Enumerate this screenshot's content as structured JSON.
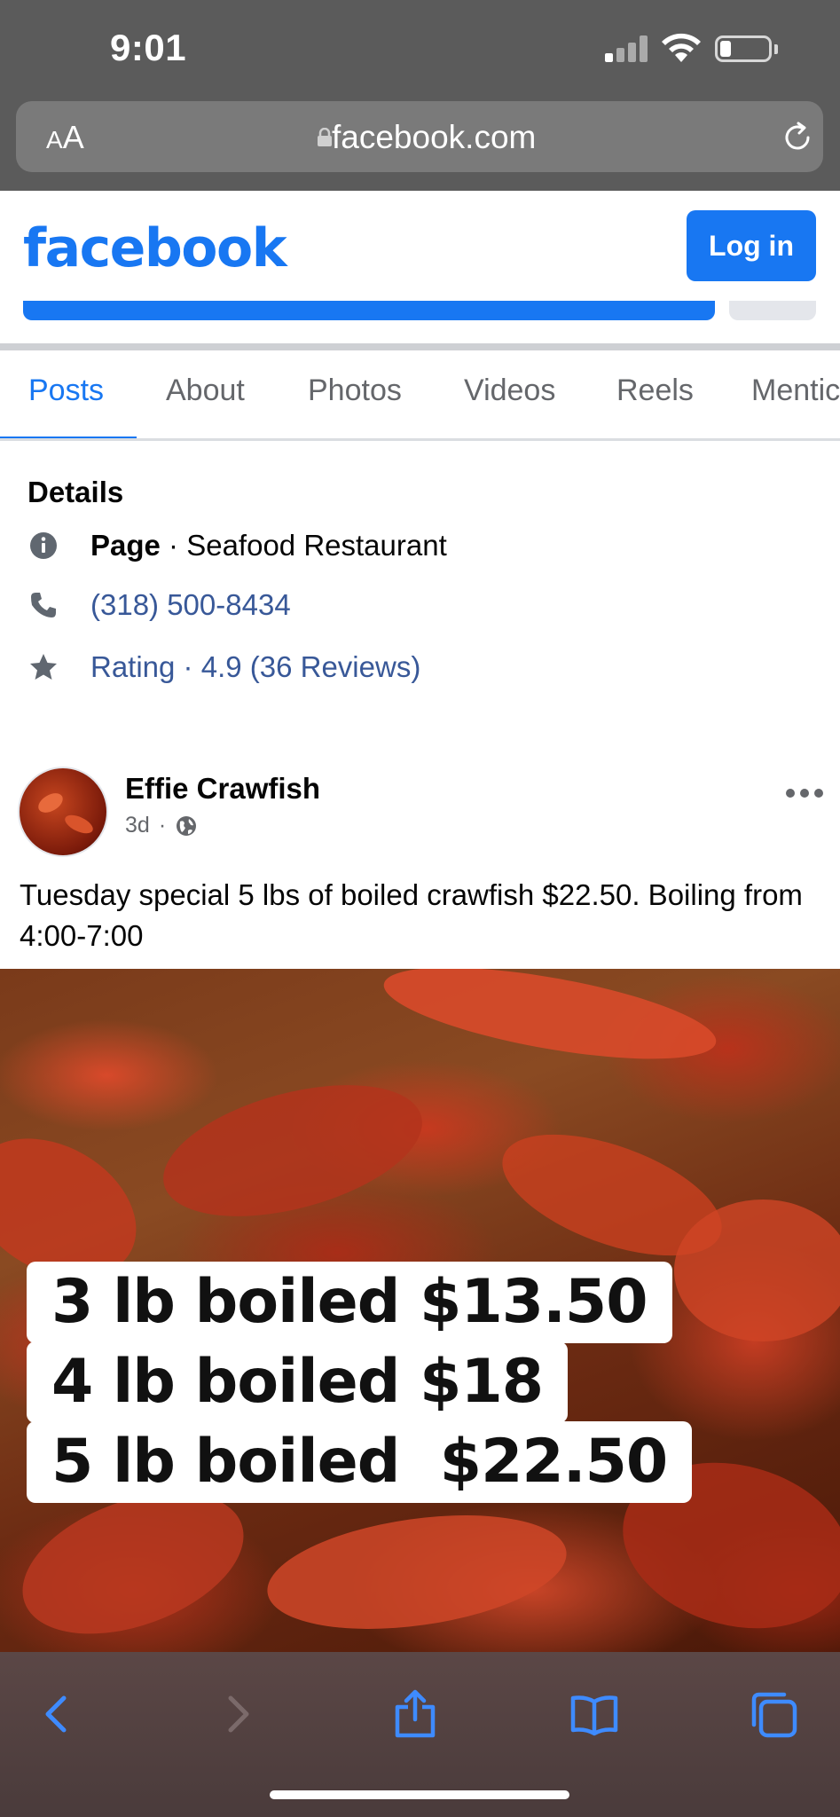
{
  "status_bar": {
    "time": "9:01"
  },
  "browser": {
    "text_size_button": {
      "small": "A",
      "big": "A"
    },
    "url": "facebook.com"
  },
  "facebook": {
    "logo": "facebook",
    "login_label": "Log in",
    "brand_color": "#1877f2"
  },
  "tabs": [
    {
      "label": "Posts",
      "active": true
    },
    {
      "label": "About",
      "active": false
    },
    {
      "label": "Photos",
      "active": false
    },
    {
      "label": "Videos",
      "active": false
    },
    {
      "label": "Reels",
      "active": false
    },
    {
      "label": "Mentic",
      "active": false
    }
  ],
  "details": {
    "title": "Details",
    "page_label": "Page",
    "page_category": " · Seafood Restaurant",
    "phone": "(318) 500-8434",
    "rating": "Rating · 4.9 (36 Reviews)"
  },
  "post": {
    "author": "Effie Crawfish",
    "time": "3d",
    "separator": "·",
    "text": "Tuesday special 5 lbs of boiled crawfish $22.50. Boiling from 4:00-7:00",
    "image_lines": [
      "3 lb boiled $13.50",
      "4 lb boiled $18",
      "5 lb boiled  $22.50"
    ]
  }
}
